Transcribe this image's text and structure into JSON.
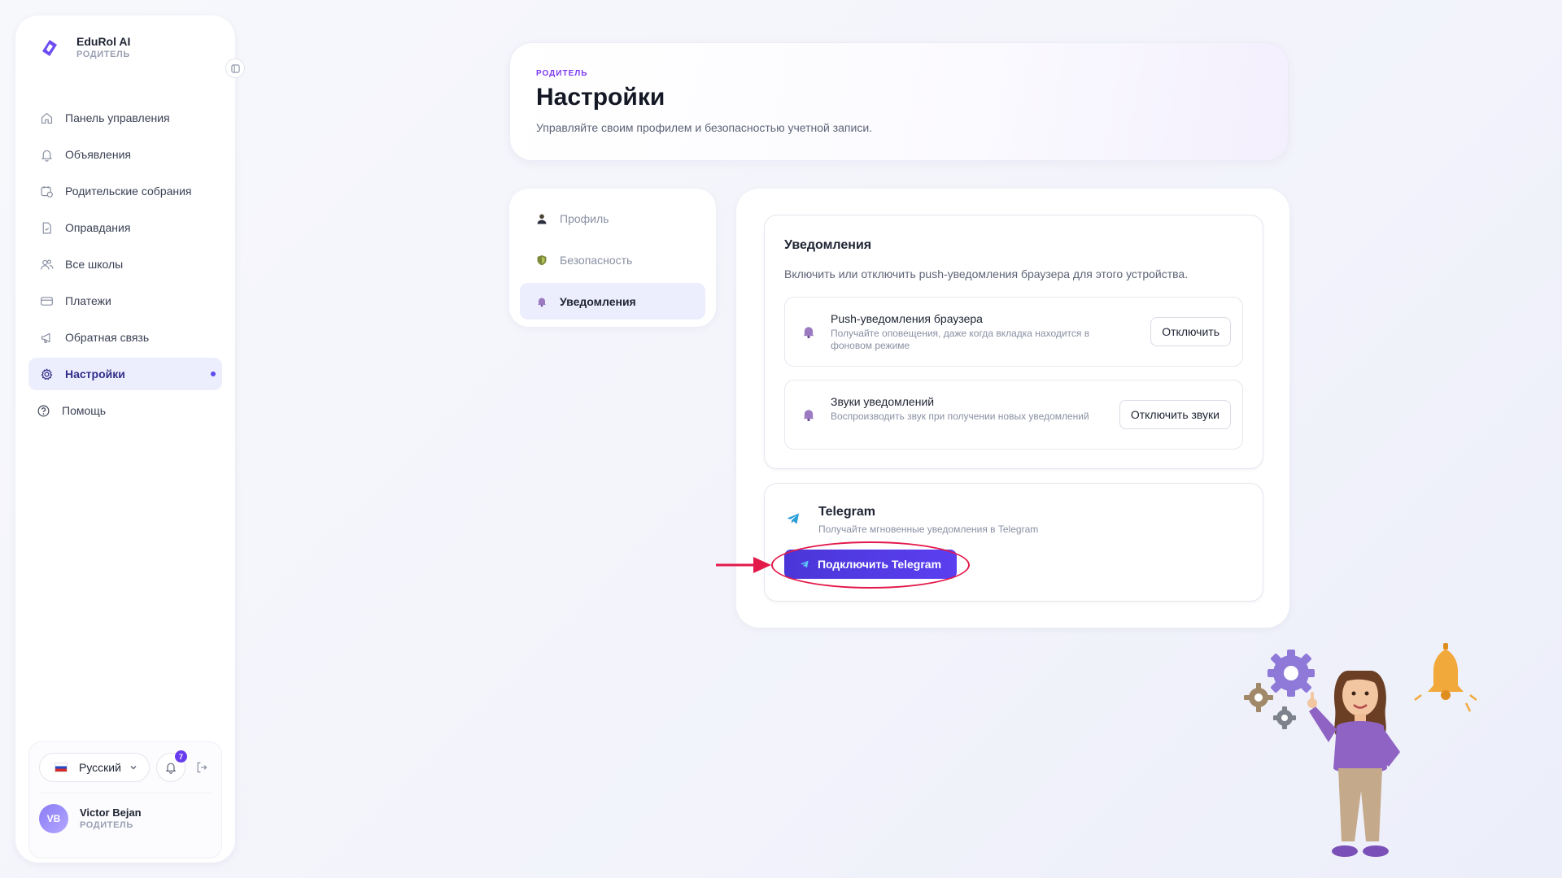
{
  "brand": {
    "name": "EduRol AI",
    "role": "РОДИТЕЛЬ"
  },
  "sidebar": {
    "items": [
      {
        "label": "Панель управления",
        "icon": "home-icon"
      },
      {
        "label": "Объявления",
        "icon": "bell-icon"
      },
      {
        "label": "Родительские собрания",
        "icon": "calendar-clock-icon"
      },
      {
        "label": "Оправдания",
        "icon": "document-icon"
      },
      {
        "label": "Все школы",
        "icon": "users-icon"
      },
      {
        "label": "Платежи",
        "icon": "credit-card-icon"
      },
      {
        "label": "Обратная связь",
        "icon": "megaphone-icon"
      },
      {
        "label": "Настройки",
        "icon": "gear-icon",
        "active": true
      }
    ],
    "help_label": "Помощь",
    "footer": {
      "language": "Русский",
      "notification_count": "7",
      "user_initials": "VB",
      "user_name": "Victor Bejan",
      "user_role": "РОДИТЕЛЬ"
    }
  },
  "header": {
    "kicker": "РОДИТЕЛЬ",
    "title": "Настройки",
    "subtitle": "Управляйте своим профилем и безопасностью учетной записи."
  },
  "tabs": [
    {
      "label": "Профиль",
      "icon": "person-emoji-icon"
    },
    {
      "label": "Безопасность",
      "icon": "shield-emoji-icon"
    },
    {
      "label": "Уведомления",
      "icon": "bell-emoji-icon",
      "active": true
    }
  ],
  "notifications": {
    "title": "Уведомления",
    "description": "Включить или отключить push-уведомления браузера для этого устройства.",
    "rows": [
      {
        "title": "Push-уведомления браузера",
        "subtitle": "Получайте оповещения, даже когда вкладка находится в фоновом режиме",
        "button": "Отключить"
      },
      {
        "title": "Звуки уведомлений",
        "subtitle": "Воспроизводить звук при получении новых уведомлений",
        "button": "Отключить звуки"
      }
    ]
  },
  "telegram": {
    "title": "Telegram",
    "subtitle": "Получайте мгновенные уведомления в Telegram",
    "button": "Подключить Telegram"
  },
  "colors": {
    "accent": "#5b3ff0",
    "active_bg": "#eceefd",
    "annotation": "#e3194a",
    "role_purple": "#7c3aed"
  }
}
